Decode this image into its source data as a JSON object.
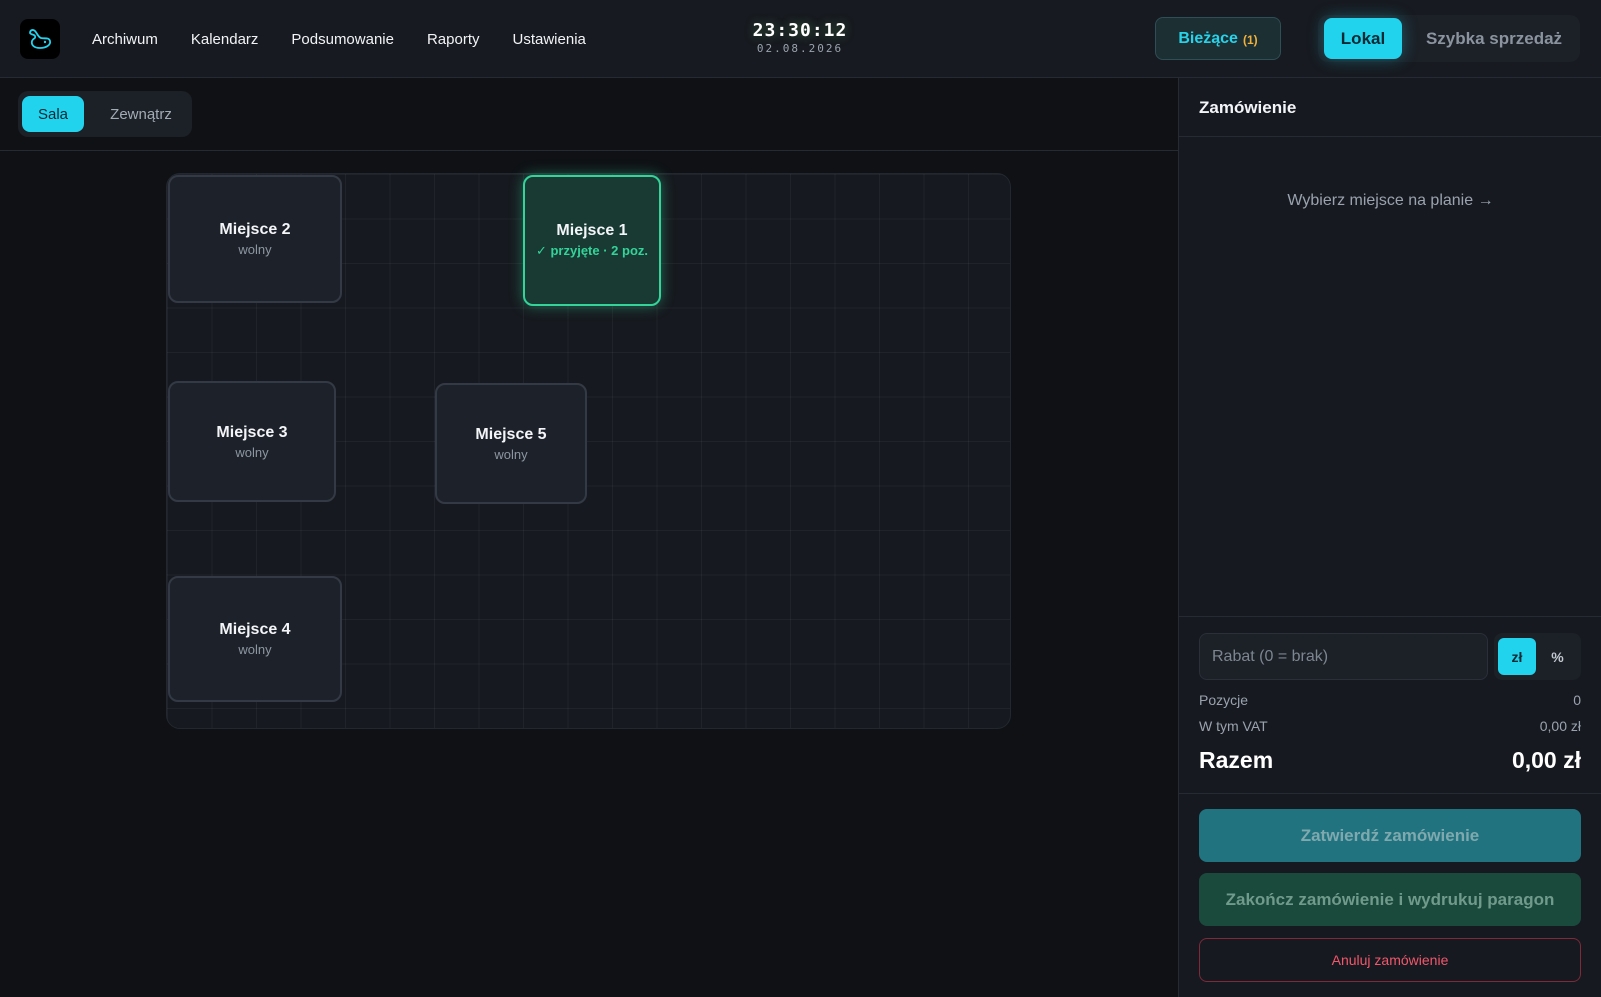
{
  "nav": {
    "items": [
      "Archiwum",
      "Kalendarz",
      "Podsumowanie",
      "Raporty",
      "Ustawienia"
    ]
  },
  "clock": {
    "time": "23:30:12",
    "date": "02.08.2026"
  },
  "current_orders": {
    "label": "Bieżące",
    "count": "(1)"
  },
  "mode": {
    "lokal": "Lokal",
    "quick_sale": "Szybka sprzedaż",
    "active": "Lokal"
  },
  "rooms": {
    "tabs": [
      "Sala",
      "Zewnątrz"
    ],
    "active": "Sala"
  },
  "tables": [
    {
      "name": "Miejsce 2",
      "status": "wolny"
    },
    {
      "name": "Miejsce 1",
      "status": "✓ przyjęte · 2 poz."
    },
    {
      "name": "Miejsce 3",
      "status": "wolny"
    },
    {
      "name": "Miejsce 5",
      "status": "wolny"
    },
    {
      "name": "Miejsce 4",
      "status": "wolny"
    }
  ],
  "order": {
    "title": "Zamówienie",
    "hint": "Wybierz miejsce na planie →",
    "discount_placeholder": "Rabat (0 = brak)",
    "discount_units": [
      "zł",
      "%"
    ],
    "active_unit": "zł",
    "positions_label": "Pozycje",
    "positions_value": "0",
    "vat_label": "W tym VAT",
    "vat_value": "0,00 zł",
    "total_label": "Razem",
    "total_value": "0,00 zł",
    "confirm_button": "Zatwierdź zamówienie",
    "finish_button": "Zakończ zamówienie i wydrukuj paragon",
    "cancel_button": "Anuluj zamówienie"
  },
  "colors": {
    "accent": "#22d3ee",
    "busy": "#34d399",
    "danger": "#f2576b",
    "badge": "#f2b13b"
  }
}
